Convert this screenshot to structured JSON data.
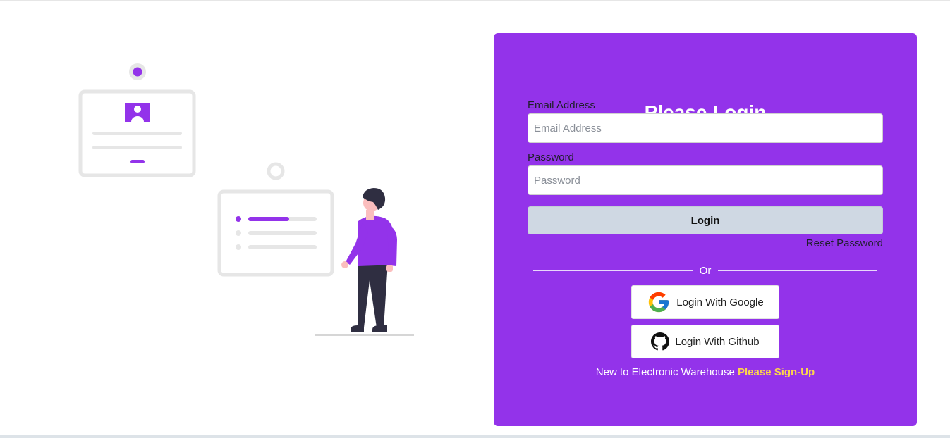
{
  "colors": {
    "brand_purple": "#9333ea",
    "login_button_bg": "#cfd8e3",
    "signup_link": "#fcd34d"
  },
  "login_card": {
    "title": "Please Login",
    "email": {
      "label": "Email Address",
      "placeholder": "Email Address",
      "value": ""
    },
    "password": {
      "label": "Password",
      "placeholder": "Password",
      "value": ""
    },
    "login_button_label": "Login",
    "reset_password_label": "Reset Password",
    "divider_text": "Or",
    "google_button_label": "Login With Google",
    "github_button_label": "Login With Github",
    "signup_prompt": "New to Electronic Warehouse",
    "signup_link_label": "Please Sign-Up"
  },
  "icons": {
    "google": "google-logo-icon",
    "github": "github-logo-icon"
  }
}
